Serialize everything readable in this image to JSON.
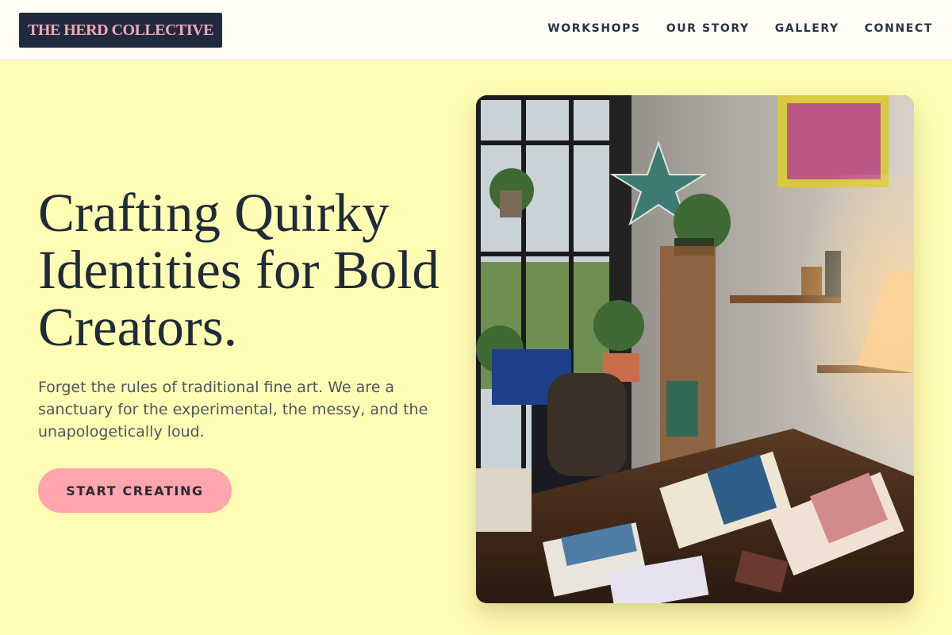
{
  "nav": {
    "logo": "THE HERD COLLECTIVE",
    "items": [
      {
        "label": "WORKSHOPS"
      },
      {
        "label": "OUR STORY"
      },
      {
        "label": "GALLERY"
      },
      {
        "label": "CONNECT"
      }
    ]
  },
  "hero": {
    "title": "Crafting Quirky Identities for Bold Creators.",
    "subtitle": "Forget the rules of traditional fine art. We are a sanctuary for the experimental, the messy, and the unapologetically loud.",
    "cta_label": "START CREATING"
  },
  "colors": {
    "background": "#fffdb3",
    "nav_bg": "#fffdf6",
    "logo_bg": "#1f2a3e",
    "logo_text": "#f4a7b4",
    "cta_bg": "#ffa5ae",
    "heading": "#1f2a3a"
  }
}
